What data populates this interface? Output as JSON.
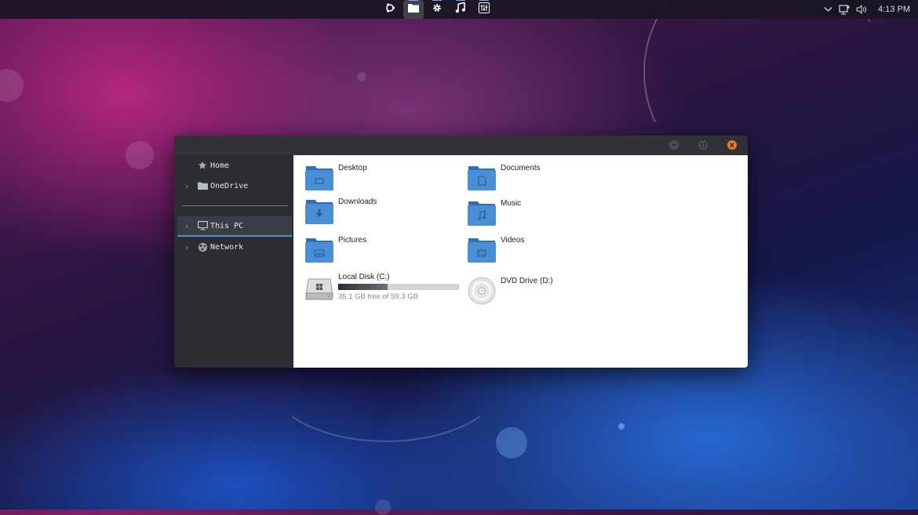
{
  "panel": {
    "dock": [
      {
        "name": "ubuntu-logo-icon",
        "active": false
      },
      {
        "name": "files-icon",
        "active": true
      },
      {
        "name": "settings-gear-icon",
        "active": false
      },
      {
        "name": "music-icon",
        "active": false
      },
      {
        "name": "mixer-icon",
        "active": false
      }
    ],
    "clock": "4:13 PM"
  },
  "sidebar": {
    "items": [
      {
        "label": "Home",
        "icon": "star-icon"
      },
      {
        "label": "OneDrive",
        "icon": "folder-icon",
        "expandable": true
      },
      {
        "label": "This PC",
        "icon": "monitor-icon",
        "expandable": true,
        "selected": true
      },
      {
        "label": "Network",
        "icon": "network-icon",
        "expandable": true
      }
    ]
  },
  "content": {
    "folders": [
      {
        "label": "Desktop",
        "glyph": "desktop"
      },
      {
        "label": "Documents",
        "glyph": "document"
      },
      {
        "label": "Downloads",
        "glyph": "download"
      },
      {
        "label": "Music",
        "glyph": "music"
      },
      {
        "label": "Pictures",
        "glyph": "picture"
      },
      {
        "label": "Videos",
        "glyph": "video"
      }
    ],
    "drives": [
      {
        "label": "Local Disk (C:)",
        "free_text": "35.1 GB free of 59.3 GB",
        "used_fraction": 0.408
      },
      {
        "label": "DVD Drive (D:)"
      }
    ]
  },
  "colors": {
    "accent": "#4a90d9",
    "close_button": "#f07c1b",
    "folder_blue": "#4a8fd6"
  }
}
